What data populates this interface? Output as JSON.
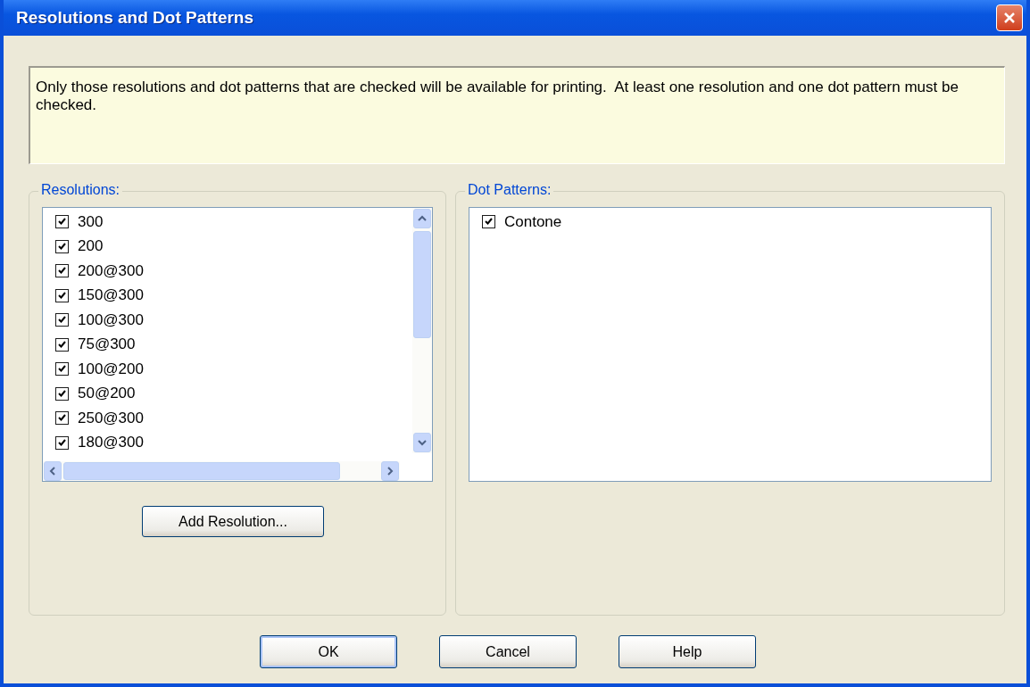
{
  "window": {
    "title": "Resolutions and Dot Patterns"
  },
  "info": "Only those resolutions and dot patterns that are checked will be available for printing.  At least one resolution and one dot pattern must be checked.",
  "resolutions": {
    "label": "Resolutions:",
    "items": [
      {
        "label": "300",
        "checked": true
      },
      {
        "label": "200",
        "checked": true
      },
      {
        "label": "200@300",
        "checked": true
      },
      {
        "label": "150@300",
        "checked": true
      },
      {
        "label": "100@300",
        "checked": true
      },
      {
        "label": "75@300",
        "checked": true
      },
      {
        "label": "100@200",
        "checked": true
      },
      {
        "label": "50@200",
        "checked": true
      },
      {
        "label": "250@300",
        "checked": true
      },
      {
        "label": "180@300",
        "checked": true
      }
    ],
    "add_button": "Add Resolution..."
  },
  "dot_patterns": {
    "label": "Dot Patterns:",
    "items": [
      {
        "label": "Contone",
        "checked": true
      }
    ]
  },
  "buttons": [
    {
      "label": "OK",
      "default": true
    },
    {
      "label": "Cancel",
      "default": false
    },
    {
      "label": "Help",
      "default": false
    }
  ]
}
